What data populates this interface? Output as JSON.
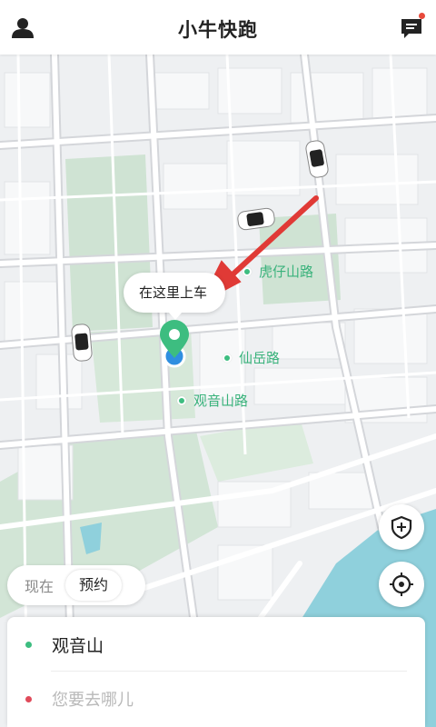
{
  "header": {
    "title": "小牛快跑",
    "user_icon": "user-icon",
    "message_icon": "message-icon",
    "has_unread": true
  },
  "map": {
    "pickup_bubble": "在这里上车",
    "pois": [
      {
        "label": "虎仔山路"
      },
      {
        "label": "仙岳路"
      },
      {
        "label": "观音山路"
      }
    ],
    "colors": {
      "background": "#eef0f2",
      "road": "#ffffff",
      "road_main": "#d7d8dc",
      "park": "#cfe3d3",
      "water": "#8fd0dc",
      "pin": "#3dbd80",
      "location": "#2f8fe0",
      "arrow": "#e03a36"
    }
  },
  "controls": {
    "safety_icon": "shield-plus-icon",
    "locate_icon": "locate-crosshair-icon"
  },
  "mode_switch": {
    "now": "现在",
    "book": "预约",
    "selected": "预约"
  },
  "trip": {
    "from": "观音山",
    "to_placeholder": "您要去哪儿",
    "from_color": "#3dbd80",
    "to_color": "#e04a5a"
  }
}
